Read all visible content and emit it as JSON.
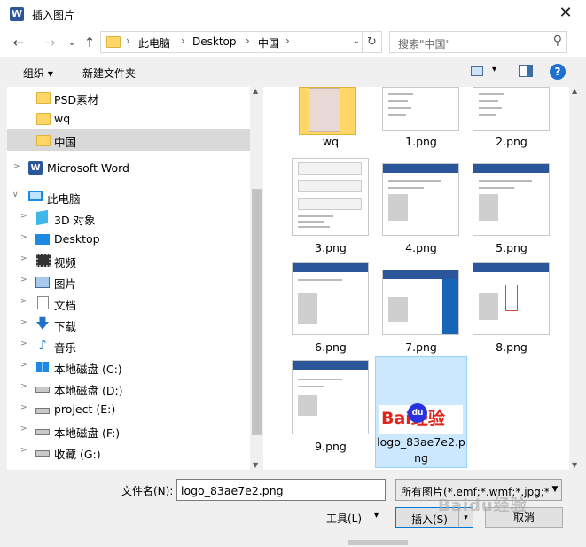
{
  "window": {
    "app_icon": "word-icon",
    "title": "插入图片",
    "close_glyph": "✕"
  },
  "address": {
    "back_glyph": "←",
    "forward_glyph": "→",
    "recent_glyph": "⌄",
    "up_glyph": "↑",
    "crumbs": [
      "此电脑",
      "Desktop",
      "中国"
    ],
    "separator": "›",
    "dropdown_glyph": "⌄",
    "refresh_glyph": "↻",
    "search_placeholder": "搜索\"中国\"",
    "search_glyph": "⚲"
  },
  "toolbar": {
    "organize": "组织 ▾",
    "new_folder": "新建文件夹",
    "view_dd": "▾",
    "help": "?"
  },
  "nav": {
    "items": [
      {
        "label": "PSD素材",
        "icon": "folder-icon"
      },
      {
        "label": "wq",
        "icon": "folder-icon"
      },
      {
        "label": "中国",
        "icon": "folder-icon",
        "selected": true
      },
      {
        "label": "Microsoft Word",
        "icon": "word-icon"
      },
      {
        "label": "此电脑",
        "icon": "computer-icon"
      },
      {
        "label": "3D 对象",
        "icon": "3d-objects-icon"
      },
      {
        "label": "Desktop",
        "icon": "desktop-icon"
      },
      {
        "label": "视频",
        "icon": "video-icon"
      },
      {
        "label": "图片",
        "icon": "pictures-icon"
      },
      {
        "label": "文档",
        "icon": "documents-icon"
      },
      {
        "label": "下载",
        "icon": "download-icon"
      },
      {
        "label": "音乐",
        "icon": "music-icon"
      },
      {
        "label": "本地磁盘 (C:)",
        "icon": "windows-drive-icon"
      },
      {
        "label": "本地磁盘 (D:)",
        "icon": "drive-icon"
      },
      {
        "label": "project (E:)",
        "icon": "drive-icon"
      },
      {
        "label": "本地磁盘 (F:)",
        "icon": "drive-icon"
      },
      {
        "label": "收藏 (G:)",
        "icon": "drive-icon"
      }
    ],
    "expand_glyph": ">",
    "collapse_glyph": "∨"
  },
  "files": [
    {
      "name": "wq",
      "type": "folder"
    },
    {
      "name": "1.png"
    },
    {
      "name": "2.png"
    },
    {
      "name": "3.png"
    },
    {
      "name": "4.png"
    },
    {
      "name": "5.png"
    },
    {
      "name": "6.png"
    },
    {
      "name": "7.png"
    },
    {
      "name": "8.png"
    },
    {
      "name": "9.png"
    },
    {
      "name_line1": "logo_83ae7e2.p",
      "name_line2": "ng",
      "selected": true,
      "logo_text": "Bai经验",
      "logo_paw": "du"
    }
  ],
  "bottom": {
    "filename_label": "文件名(N):",
    "filename_value": "logo_83ae7e2.png",
    "filter_value": "所有图片(*.emf;*.wmf;*.jpg;*.jp",
    "tools": "工具(L)",
    "tools_dd": "▾",
    "insert": "插入(S)",
    "insert_dd": "▾",
    "cancel": "取消"
  },
  "scroll": {
    "up": "▲",
    "down": "▼"
  },
  "watermark": "Baidu经验",
  "colors": {
    "selection": "#cce8ff",
    "nav_selected": "#d9d9d9",
    "word_blue": "#2b579a",
    "accent": "#0078d7"
  }
}
